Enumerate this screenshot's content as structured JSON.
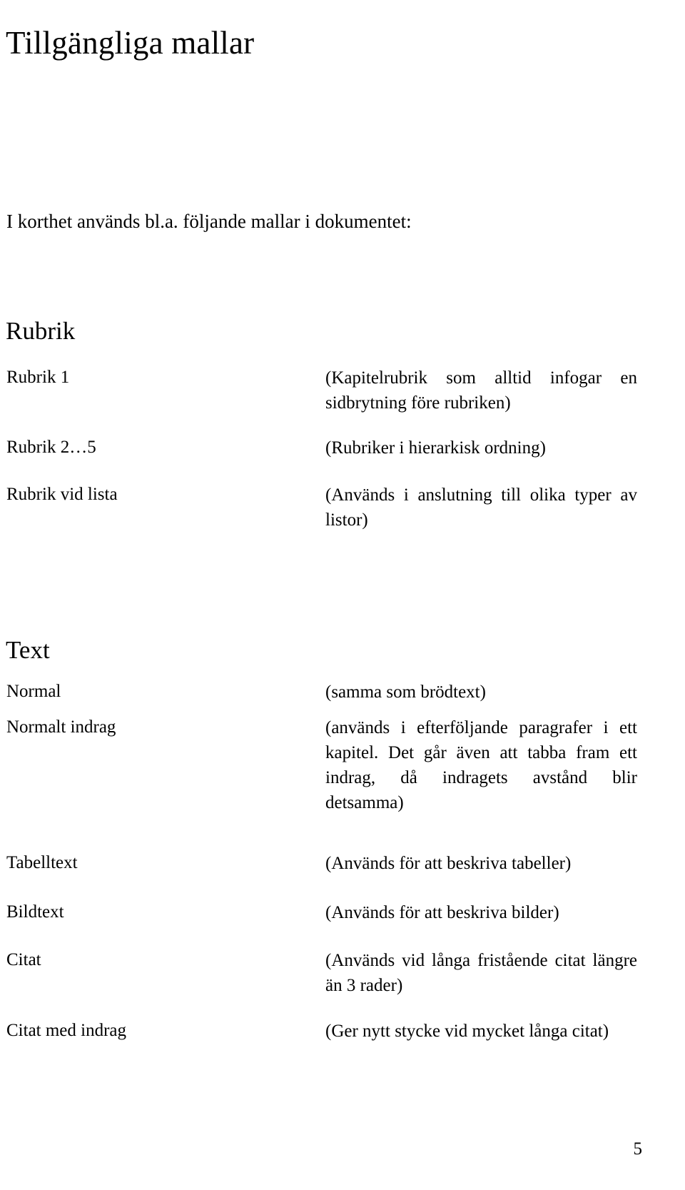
{
  "document": {
    "title": "Tillgängliga mallar",
    "intro": "I korthet används bl.a. följande mallar i dokumentet:",
    "page_number": "5"
  },
  "sections": [
    {
      "heading": "Rubrik",
      "rows": [
        {
          "label": "Rubrik 1",
          "description": "(Kapitelrubrik som alltid infogar en sidbrytning före rubriken)"
        },
        {
          "label": "Rubrik 2…5",
          "description": "(Rubriker i hierarkisk ordning)"
        },
        {
          "label": "Rubrik vid lista",
          "description": "(Används i anslutning till olika typer av listor)"
        }
      ]
    },
    {
      "heading": "Text",
      "rows": [
        {
          "label": "Normal",
          "description": "(samma som brödtext)"
        },
        {
          "label": "Normalt indrag",
          "description": "(används i efterföljande paragrafer i ett kapitel. Det går även att tabba fram ett indrag, då indragets avstånd blir detsamma)"
        },
        {
          "label": "Tabelltext",
          "description": "(Används för att beskriva tabeller)"
        },
        {
          "label": "Bildtext",
          "description": "(Används för att beskriva bilder)"
        },
        {
          "label": "Citat",
          "description": "(Används vid långa fristående citat längre än 3 rader)"
        },
        {
          "label": "Citat med indrag",
          "description": "(Ger nytt stycke vid mycket långa citat)"
        }
      ]
    }
  ]
}
